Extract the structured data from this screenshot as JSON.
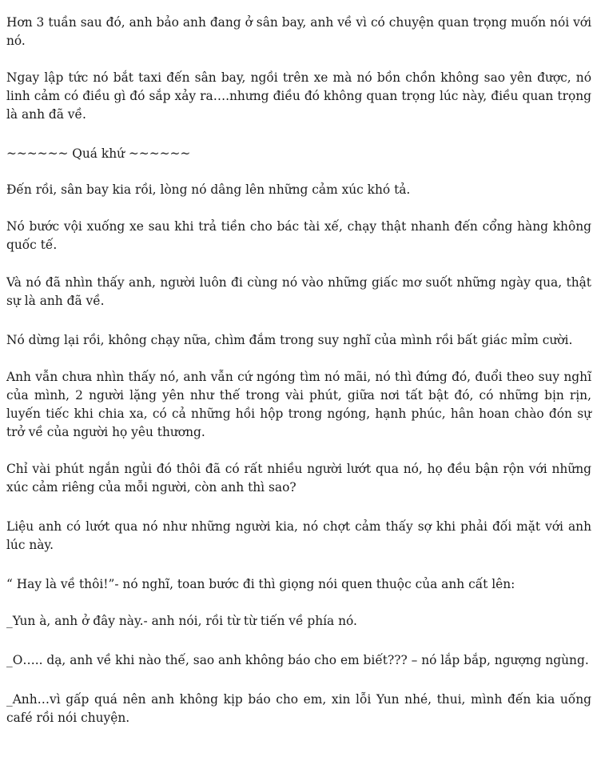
{
  "paragraphs": [
    {
      "text": "Hơn 3 tuần sau đó, anh bảo anh đang ở sân bay, anh về vì có chuyện quan trọng muốn nói với nó."
    },
    {
      "text": "Ngay lập tức nó bắt taxi đến sân bay, ngồi trên xe mà nó bồn chồn không sao yên được, nó linh cảm có điều gì đó sắp xảy ra….nhưng điều đó không quan trọng lúc này, điều quan trọng là anh đã về."
    },
    {
      "text": "~~~~~~ Quá khứ ~~~~~~"
    },
    {
      "text": "Đến rồi, sân bay kia rồi, lòng nó dâng lên những cảm xúc khó tả."
    },
    {
      "text": "Nó bước vội xuống xe sau khi trả tiền cho bác tài xế, chạy thật nhanh đến cổng hàng không quốc tế."
    },
    {
      "text": "Và nó đã nhìn thấy anh, người luôn đi cùng nó vào những giấc mơ suốt những ngày qua, thật sự là anh đã về."
    },
    {
      "text": "Nó dừng lại rồi, không chạy nữa, chìm đắm trong suy nghĩ của mình rồi bất giác mỉm cười."
    },
    {
      "text": "Anh vẫn chưa nhìn thấy nó, anh vẫn cứ ngóng tìm nó mãi, nó thì đứng đó, đuổi theo suy nghĩ của mình, 2 người lặng yên như thế trong vài phút, giữa nơi tất bật đó, có những bịn rịn, luyến tiếc khi chia xa, có cả những hồi hộp trong ngóng, hạnh phúc, hân hoan chào đón sự trở về của người họ yêu thương."
    },
    {
      "text": "Chỉ vài phút ngắn ngủi đó thôi đã có rất nhiều người lướt qua nó, họ đều bận rộn với những xúc cảm riêng của mỗi người, còn anh thì sao?"
    },
    {
      "text": "Liệu anh có lướt qua nó như những người kia, nó chợt cảm thấy sợ khi phải đối mặt với anh lúc này."
    },
    {
      "text": "“ Hay là về thôi!”- nó nghĩ, toan bước đi thì giọng nói quen thuộc của anh cất lên:"
    },
    {
      "text": "_Yun à, anh ở đây này.- anh nói, rồi từ từ tiến về phía nó."
    },
    {
      "text": "_O….. dạ, anh về khi nào thế, sao anh không báo cho em biết??? – nó lắp bắp, ngượng ngùng."
    },
    {
      "text": "_Anh…vì gấp quá nên anh không kịp báo cho em, xin lỗi Yun nhé, thui, mình đến kia uống café rồi nói chuyện."
    }
  ]
}
